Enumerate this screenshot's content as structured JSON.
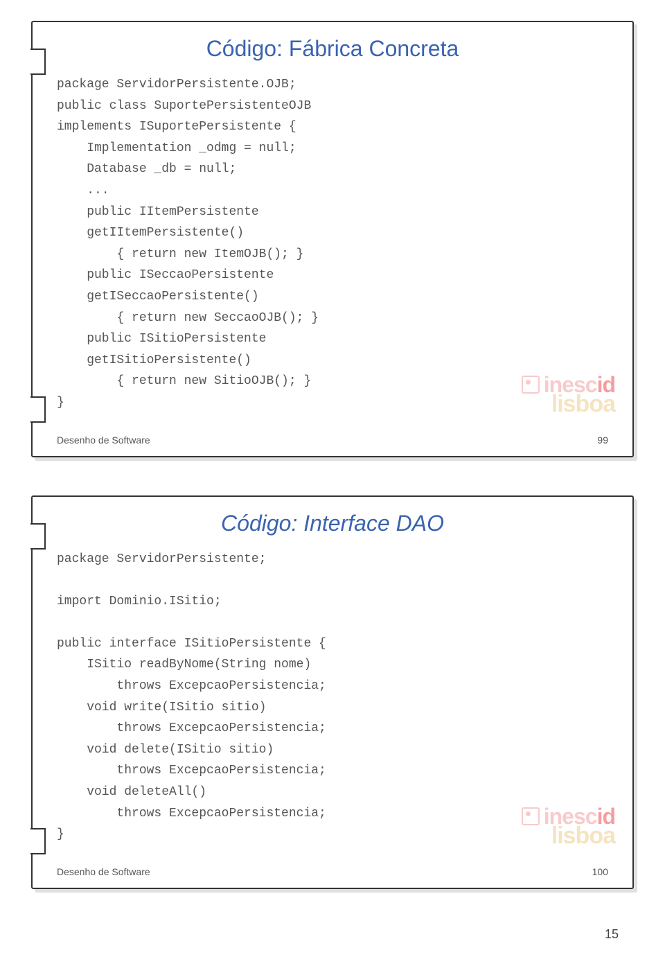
{
  "slides": [
    {
      "title": "Código: Fábrica Concreta",
      "code": "package ServidorPersistente.OJB;\npublic class SuportePersistenteOJB\nimplements ISuportePersistente {\n    Implementation _odmg = null;\n    Database _db = null;\n    ...\n    public IItemPersistente\n    getIItemPersistente()\n        { return new ItemOJB(); }\n    public ISeccaoPersistente\n    getISeccaoPersistente()\n        { return new SeccaoOJB(); }\n    public ISitioPersistente\n    getISitioPersistente()\n        { return new SitioOJB(); }\n}",
      "footer_left": "Desenho de Software",
      "footer_right": "99"
    },
    {
      "title": "Código: Interface DAO",
      "code": "package ServidorPersistente;\n\nimport Dominio.ISitio;\n\npublic interface ISitioPersistente {\n    ISitio readByNome(String nome)\n        throws ExcepcaoPersistencia;\n    void write(ISitio sitio)\n        throws ExcepcaoPersistencia;\n    void delete(ISitio sitio)\n        throws ExcepcaoPersistencia;\n    void deleteAll()\n        throws ExcepcaoPersistencia;\n}",
      "footer_left": "Desenho de Software",
      "footer_right": "100"
    }
  ],
  "watermark": {
    "brand1a": "inesc",
    "brand1b": "id",
    "brand2": "lisboa"
  },
  "page_number": "15"
}
